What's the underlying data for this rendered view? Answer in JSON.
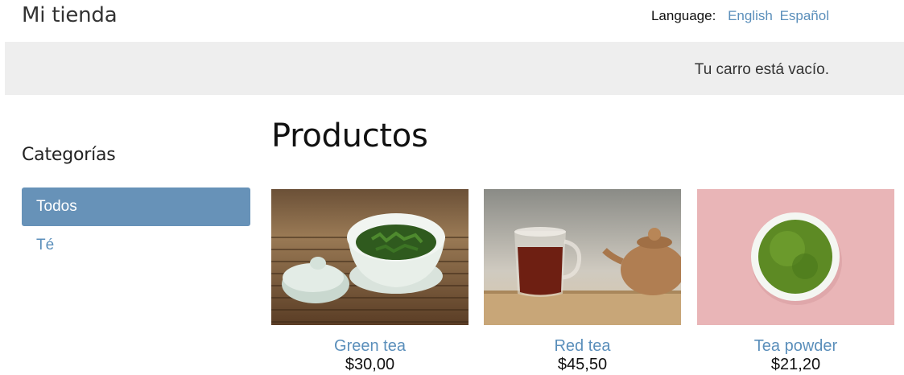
{
  "header": {
    "title": "Mi tienda",
    "language_label": "Language:",
    "languages": [
      "English",
      "Español"
    ]
  },
  "cart": {
    "status": "Tu carro está vacío."
  },
  "sidebar": {
    "title": "Categorías",
    "items": [
      {
        "label": "Todos",
        "selected": true
      },
      {
        "label": "Té",
        "selected": false
      }
    ]
  },
  "main": {
    "title": "Productos",
    "products": [
      {
        "name": "Green tea",
        "price": "$30,00"
      },
      {
        "name": "Red tea",
        "price": "$45,50"
      },
      {
        "name": "Tea powder",
        "price": "$21,20"
      }
    ]
  },
  "colors": {
    "accent": "#6792b8",
    "link": "#5b8fbb",
    "cart_bg": "#eeeeee"
  }
}
